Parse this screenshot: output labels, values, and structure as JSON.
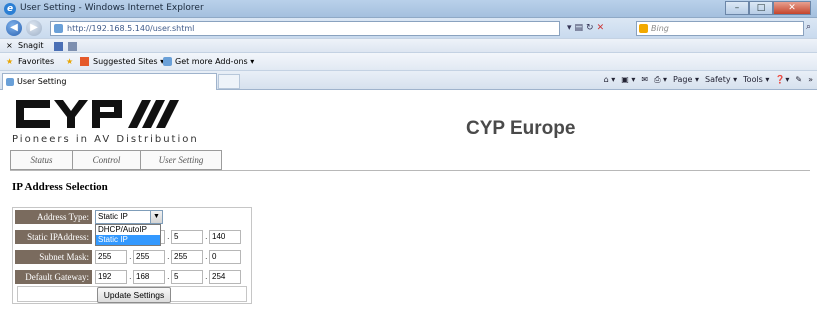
{
  "browser": {
    "window_title": "User Setting - Windows Internet Explorer",
    "address": "http://192.168.5.140/user.shtml",
    "search_placeholder": "Bing",
    "toolbar1": {
      "close": "×",
      "snagit": "Snagit"
    },
    "favorites": {
      "label": "Favorites",
      "suggested": "Suggested Sites ▾",
      "addons": "Get more Add-ons ▾"
    },
    "tab_title": "User Setting",
    "command_bar": [
      "Page ▾",
      "Safety ▾",
      "Tools ▾"
    ]
  },
  "page": {
    "company": "CYP Europe",
    "tagline": "Pioneers in AV Distribution",
    "nav_tabs": [
      "Status",
      "Control",
      "User Setting"
    ],
    "section_title": "IP Address Selection",
    "form": {
      "address_type_label": "Address Type:",
      "address_type_value": "Static IP",
      "address_type_options": [
        "DHCP/AutoIP",
        "Static IP"
      ],
      "static_ip_label": "Static IPAddress:",
      "static_ip": [
        "",
        "",
        "5",
        "140"
      ],
      "subnet_label": "Subnet Mask:",
      "subnet": [
        "255",
        "255",
        "255",
        "0"
      ],
      "gateway_label": "Default Gateway:",
      "gateway": [
        "192",
        "168",
        "5",
        "254"
      ],
      "update_button": "Update Settings"
    }
  },
  "colors": {
    "label_bg": "#7a6b5e",
    "selected_option": "#3399ff",
    "company_text": "#4a4a4a"
  }
}
